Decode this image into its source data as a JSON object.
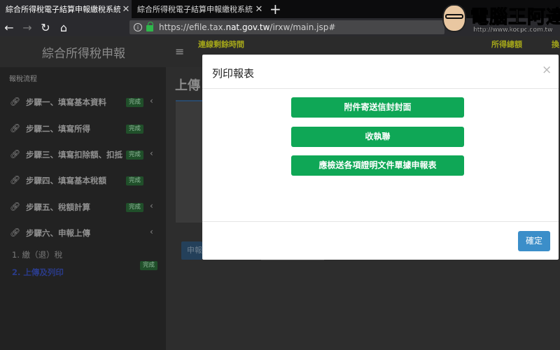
{
  "browser": {
    "tabs": [
      {
        "label": "綜合所得稅電子結算申報繳稅系統",
        "close": "✕"
      },
      {
        "label": "綜合所得稅電子結算申報繳稅系統",
        "close": "✕"
      }
    ],
    "new_tab": "+",
    "url_prefix": "https://efile.tax.",
    "url_host": "nat.gov.tw",
    "url_path": "/irxw/main.jsp#"
  },
  "watermark": {
    "brand": "電腦王阿達",
    "url": "http://www.kocpc.com.tw"
  },
  "app": {
    "title": "綜合所得稅申報",
    "menu_icon": "≡",
    "header_left": "連線剩餘時間",
    "header_right": "所得總額",
    "header_right2": "換"
  },
  "sidebar": {
    "heading": "報稅流程",
    "steps": [
      {
        "label": "步驟一、填寫基本資料",
        "badge": "完成",
        "chevron": "‹"
      },
      {
        "label": "步驟二、填寫所得",
        "badge": "完成",
        "chevron": ""
      },
      {
        "label": "步驟三、填寫扣除額、扣抵",
        "badge": "完成",
        "chevron": "‹"
      },
      {
        "label": "步驟四、填寫基本稅額",
        "badge": "完成",
        "chevron": ""
      },
      {
        "label": "步驟五、稅額計算",
        "badge": "完成",
        "chevron": "‹"
      },
      {
        "label": "步驟六、申報上傳",
        "badge": "",
        "chevron": "‹"
      }
    ],
    "substeps": [
      {
        "label": "1. 繳（退）稅"
      },
      {
        "label": "2. 上傳及列印",
        "badge": "完成"
      }
    ]
  },
  "main": {
    "title": "上傳",
    "bg_button": "申報"
  },
  "modal": {
    "title": "列印報表",
    "close": "×",
    "buttons": [
      "附件寄送信封封面",
      "收執聯",
      "應檢送各項證明文件單據申報表"
    ],
    "ok": "確定"
  },
  "colors": {
    "green_button": "#0fa756",
    "ok_button": "#3b8ec9",
    "badge": "#204f2a",
    "header_accent": "#a3a51a"
  }
}
